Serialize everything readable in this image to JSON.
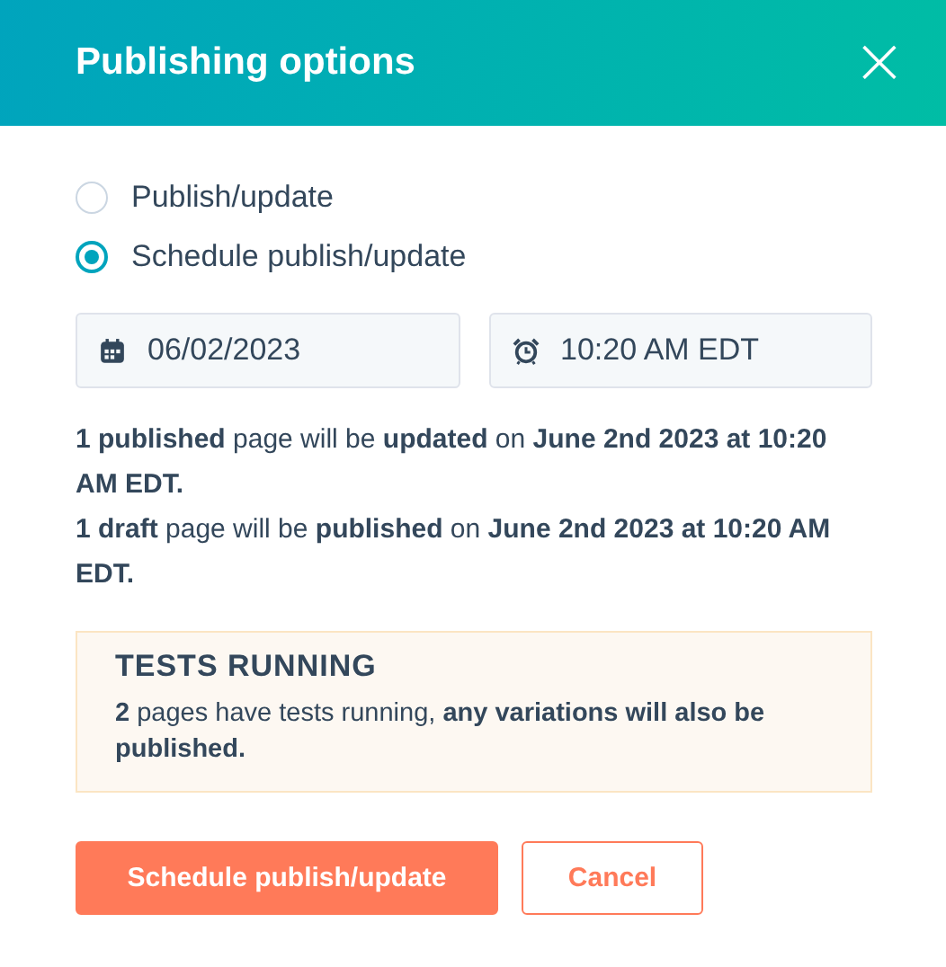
{
  "dialog": {
    "title": "Publishing options",
    "close": "×"
  },
  "options": [
    {
      "label": "Publish/update",
      "selected": false
    },
    {
      "label": "Schedule publish/update",
      "selected": true
    }
  ],
  "date_field": {
    "value": "06/02/2023"
  },
  "time_field": {
    "value": "10:20 AM EDT"
  },
  "summary": [
    "**1 published** page will be **updated** on **June 2nd 2023 at 10:20 AM EDT.**",
    "**1 draft** page will be **published** on **June 2nd 2023 at 10:20 AM EDT.**"
  ],
  "alert": {
    "title": "TESTS RUNNING",
    "text": "**2** pages have tests running, **any variations will also be published.**"
  },
  "buttons": [
    {
      "label": "Schedule publish/update",
      "kind": "primary"
    },
    {
      "label": "Cancel",
      "kind": "secondary"
    }
  ]
}
